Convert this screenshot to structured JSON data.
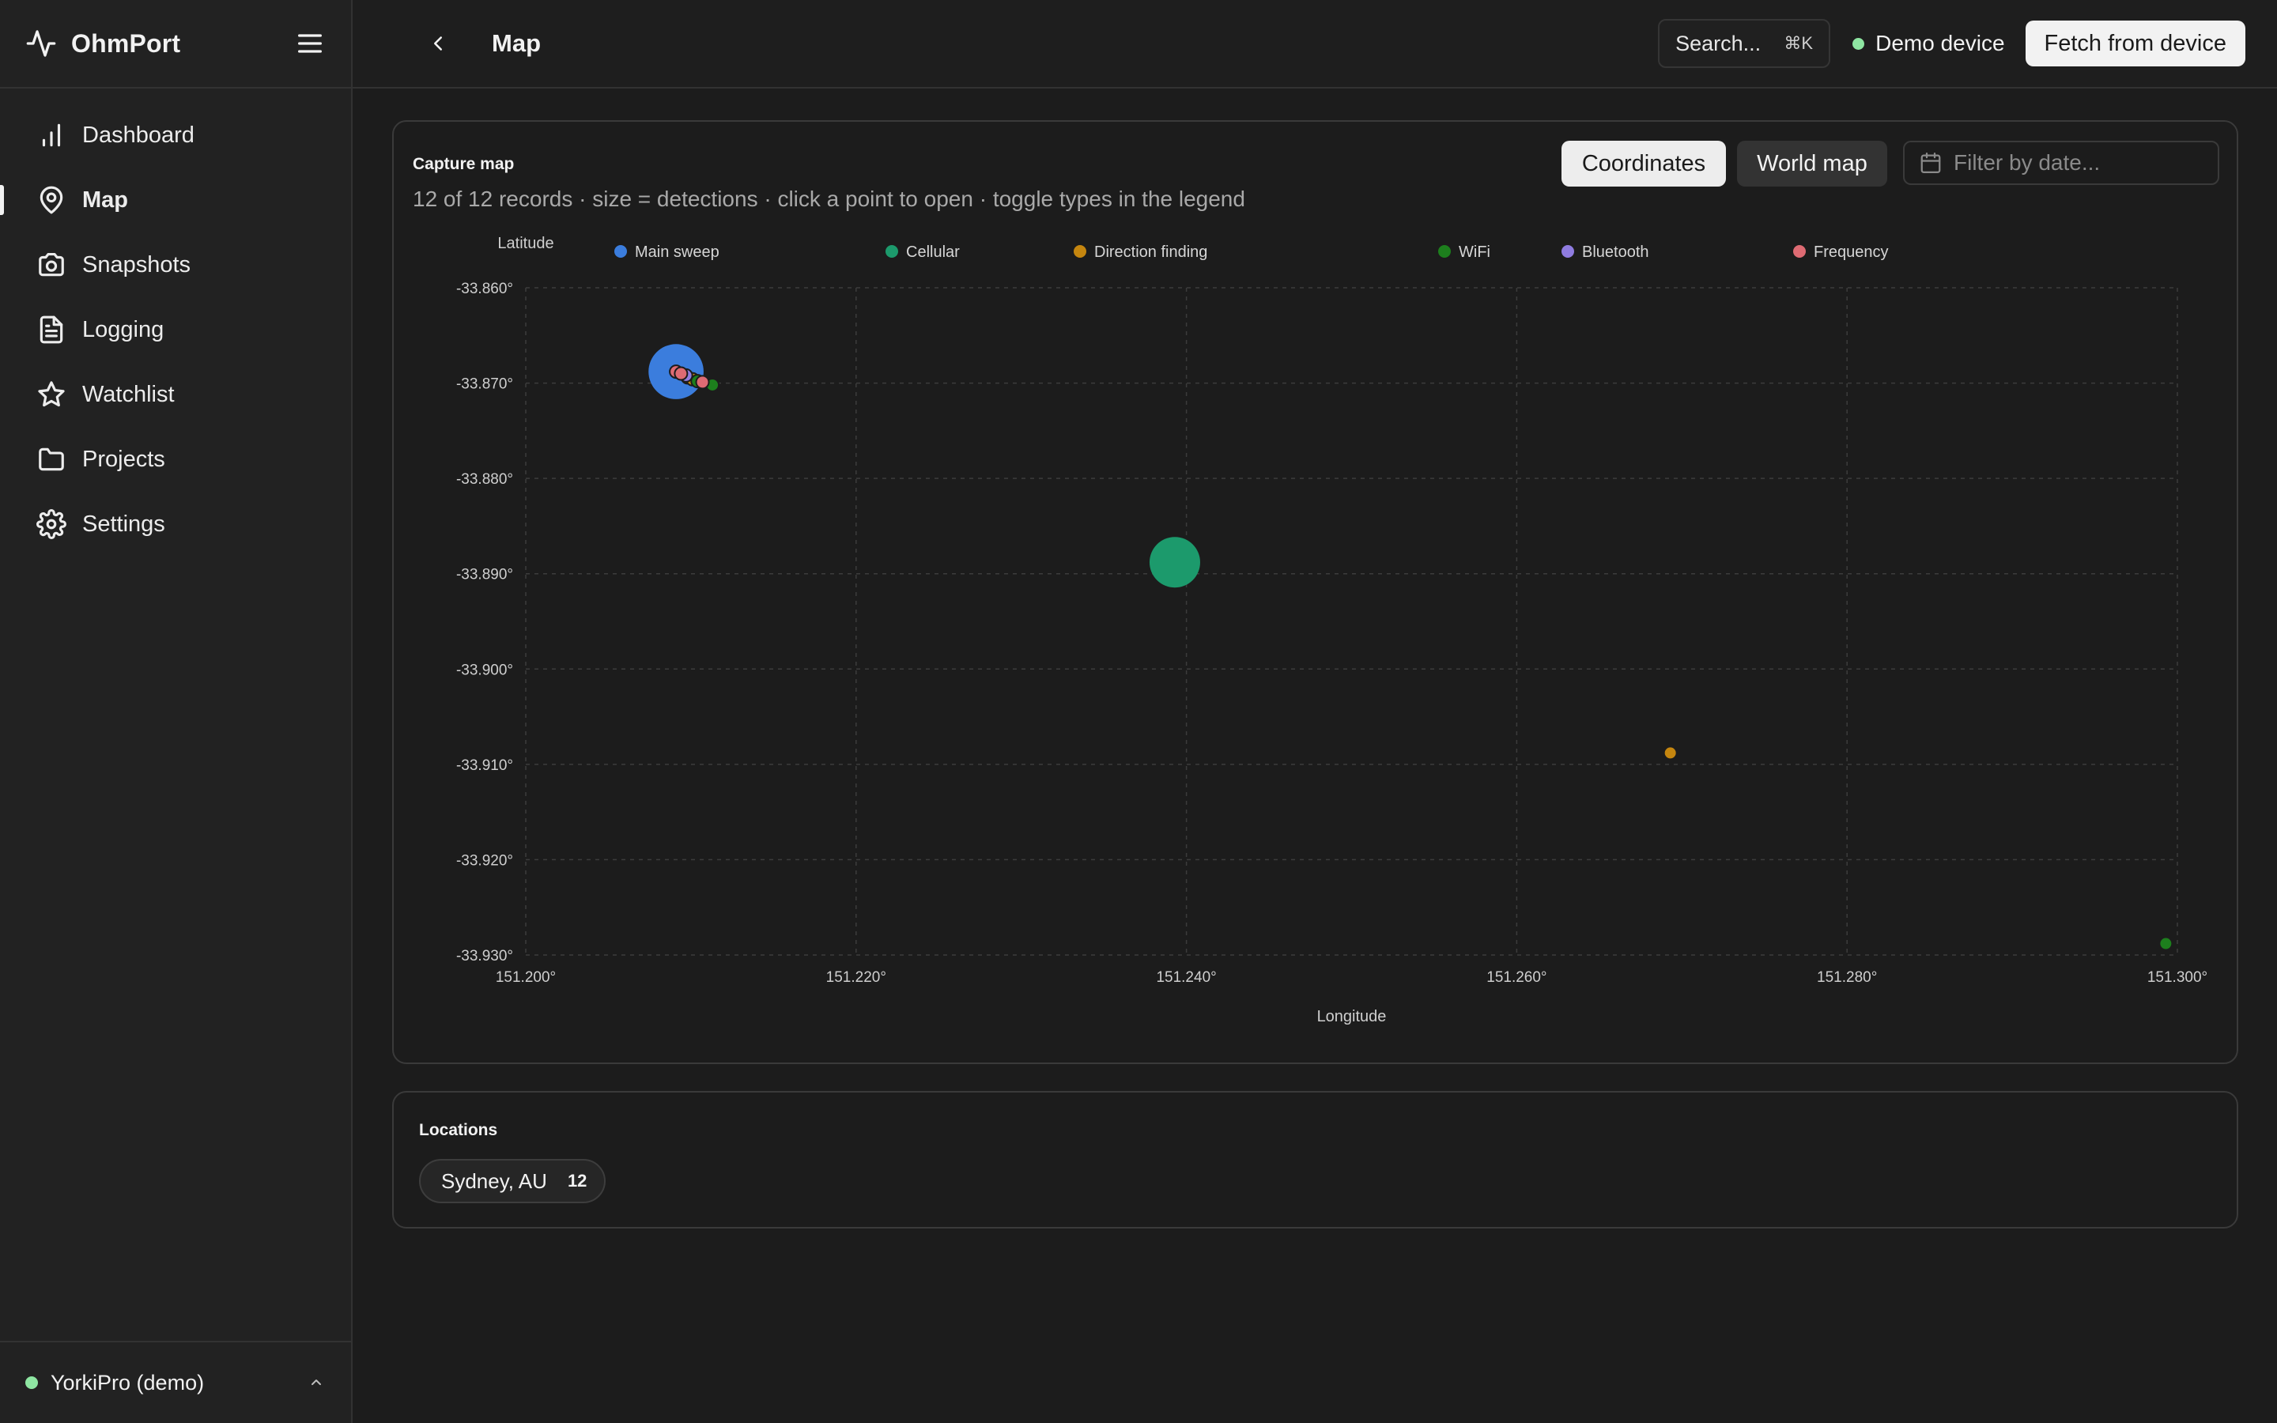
{
  "app": {
    "name": "OhmPort"
  },
  "sidebar": {
    "items": [
      {
        "label": "Dashboard",
        "icon": "bar-chart-icon",
        "active": false
      },
      {
        "label": "Map",
        "icon": "map-pin-icon",
        "active": true
      },
      {
        "label": "Snapshots",
        "icon": "camera-icon",
        "active": false
      },
      {
        "label": "Logging",
        "icon": "file-text-icon",
        "active": false
      },
      {
        "label": "Watchlist",
        "icon": "star-icon",
        "active": false
      },
      {
        "label": "Projects",
        "icon": "folder-icon",
        "active": false
      },
      {
        "label": "Settings",
        "icon": "gear-icon",
        "active": false
      }
    ],
    "footer": {
      "label": "YorkiPro (demo)"
    }
  },
  "topbar": {
    "title": "Map",
    "search_label": "Search...",
    "search_shortcut": "⌘K",
    "device_label": "Demo device",
    "fetch_label": "Fetch from device"
  },
  "map_card": {
    "title": "Capture map",
    "subtitle": "12 of 12 records · size = detections · click a point to open · toggle types in the legend",
    "view_coordinates": "Coordinates",
    "view_world": "World map",
    "date_placeholder": "Filter by date..."
  },
  "locations": {
    "title": "Locations",
    "items": [
      {
        "label": "Sydney, AU",
        "count": "12"
      }
    ]
  },
  "chart_data": {
    "type": "scatter",
    "xlabel": "Longitude",
    "ylabel": "Latitude",
    "xlim": [
      151.2,
      151.3
    ],
    "ylim": [
      -33.93,
      -33.86
    ],
    "xticks": [
      "151.200°",
      "151.220°",
      "151.240°",
      "151.260°",
      "151.280°",
      "151.300°"
    ],
    "yticks": [
      "-33.860°",
      "-33.870°",
      "-33.880°",
      "-33.890°",
      "-33.900°",
      "-33.910°",
      "-33.920°",
      "-33.930°"
    ],
    "grid": true,
    "legend_position": "top",
    "series": [
      {
        "name": "Main sweep",
        "color": "#3b7ddd",
        "points": [
          {
            "x": 151.2091,
            "y": -33.8688,
            "detections": 6
          }
        ]
      },
      {
        "name": "Cellular",
        "color": "#1c9a6c",
        "points": [
          {
            "x": 151.2393,
            "y": -33.8888,
            "detections": 5
          },
          {
            "x": 151.2098,
            "y": -33.8694,
            "detections": 1
          }
        ]
      },
      {
        "name": "Direction finding",
        "color": "#c5860f",
        "points": [
          {
            "x": 151.2693,
            "y": -33.9088,
            "detections": 1
          },
          {
            "x": 151.2101,
            "y": -33.8696,
            "detections": 1
          }
        ]
      },
      {
        "name": "WiFi",
        "color": "#1d7f1d",
        "points": [
          {
            "x": 151.2993,
            "y": -33.9288,
            "detections": 1
          },
          {
            "x": 151.2113,
            "y": -33.8702,
            "detections": 1
          },
          {
            "x": 151.2104,
            "y": -33.8698,
            "detections": 1
          }
        ]
      },
      {
        "name": "Bluetooth",
        "color": "#8f7ce0",
        "points": [
          {
            "x": 151.2097,
            "y": -33.8692,
            "detections": 1
          }
        ]
      },
      {
        "name": "Frequency",
        "color": "#de6b73",
        "points": [
          {
            "x": 151.2091,
            "y": -33.8688,
            "detections": 1
          },
          {
            "x": 151.2094,
            "y": -33.869,
            "detections": 1
          },
          {
            "x": 151.2107,
            "y": -33.8699,
            "detections": 1
          }
        ]
      }
    ]
  }
}
